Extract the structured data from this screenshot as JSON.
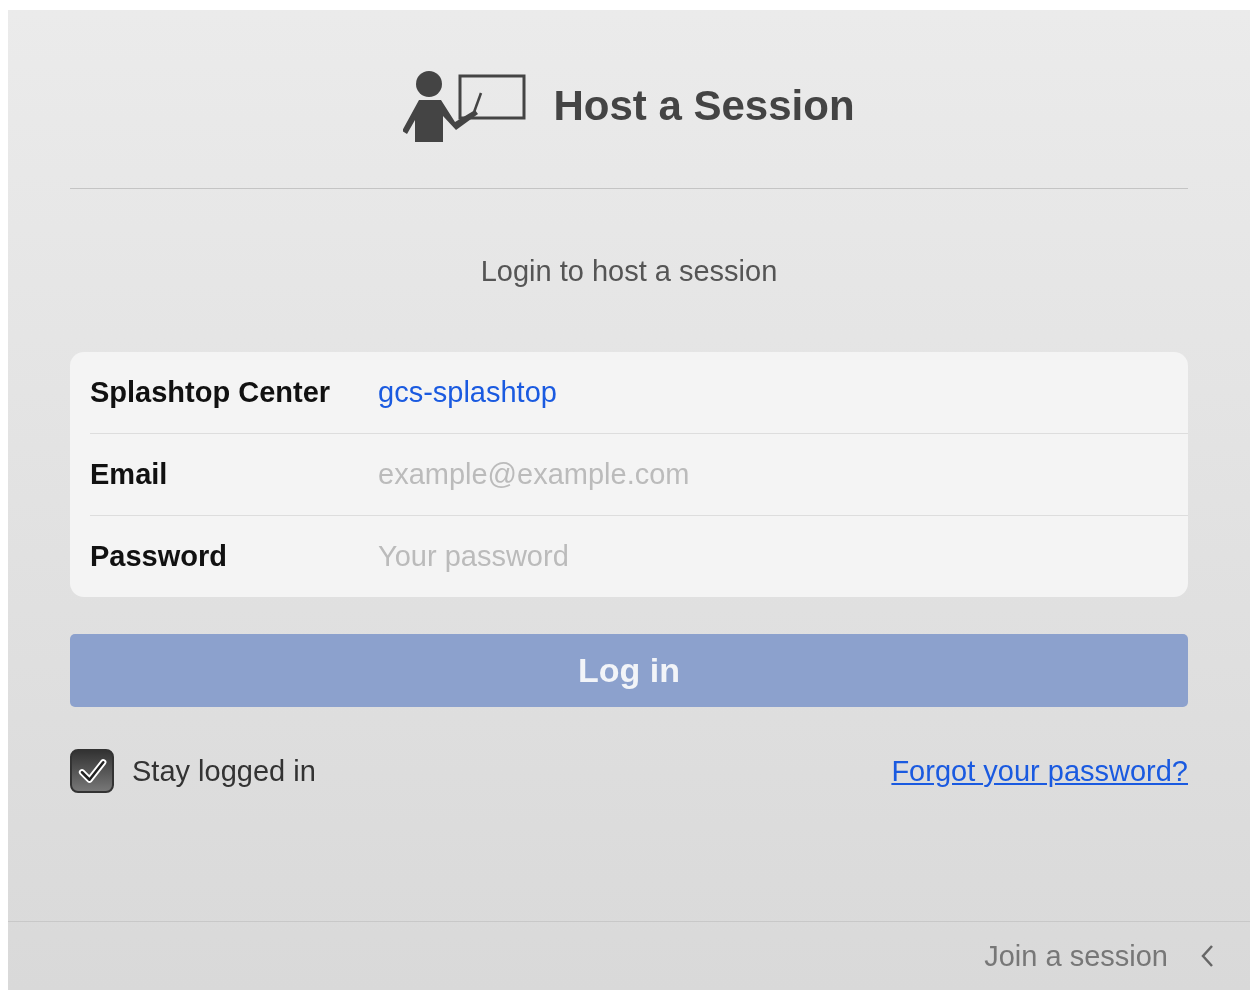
{
  "header": {
    "title": "Host a Session"
  },
  "subtitle": "Login to host a session",
  "fields": [
    {
      "label": "Splashtop Center",
      "value": "gcs-splashtop"
    },
    {
      "label": "Email",
      "placeholder": "example@example.com"
    },
    {
      "label": "Password",
      "placeholder": "Your password"
    }
  ],
  "login_button": {
    "label": "Log in",
    "disabled": true
  },
  "stay_logged_in": {
    "label": "Stay logged in",
    "checked": true
  },
  "forgot_link": "Forgot your password?",
  "footer": {
    "link": "Join a session"
  }
}
